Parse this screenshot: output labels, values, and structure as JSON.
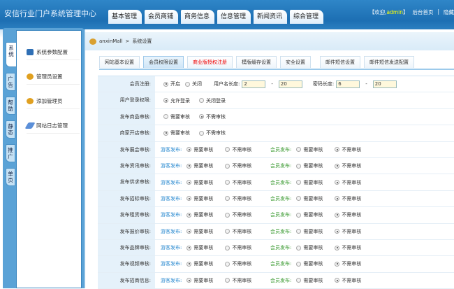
{
  "header": {
    "title": "安信行业门户系统管理中心",
    "nav": [
      "基本管理",
      "会员商铺",
      "商务信息",
      "信息管理",
      "新闻资讯",
      "综合管理"
    ],
    "welcome_prefix": "【欢迎,",
    "user": "admin",
    "welcome_suffix": "】",
    "home": "后台首页",
    "sep": "|",
    "hide": "隐藏"
  },
  "sidebar": {
    "tabs": [
      "系统",
      "广告",
      "帮助",
      "静态",
      "推广",
      "单页"
    ],
    "items": [
      {
        "label": "系统参数配置",
        "icon": "monitor-icon"
      },
      {
        "label": "管理员设置",
        "icon": "user-edit-icon"
      },
      {
        "label": "添加管理员",
        "icon": "user-add-icon"
      },
      {
        "label": "网站日志管理",
        "icon": "pen-icon"
      }
    ]
  },
  "breadcrumb": {
    "site": "anxinMall",
    "sep": ">",
    "page": "系统设置"
  },
  "tabs": [
    "网站基本设置",
    "会员权限设置",
    "商业版授权注册",
    "模版缓存设置",
    "安全设置",
    "邮件短信设置",
    "邮件短信发送配置"
  ],
  "active_tab": 1,
  "form": {
    "register": {
      "label": "会员注册:",
      "open": "开启",
      "close": "关闭",
      "selected": "开启",
      "username_label": "用户名长度:",
      "username_min": "2",
      "username_max": "20",
      "dash": "-",
      "password_label": "密码长度:",
      "password_min": "6",
      "password_max": "20"
    },
    "login": {
      "label": "用户登录权限:",
      "options": [
        "允许登录",
        "关闭登录"
      ],
      "selected": 0
    },
    "goods": {
      "label": "发布商品审核:",
      "options": [
        "需要审核",
        "不需审核"
      ],
      "selected": 1
    },
    "shop": {
      "label": "商家开店审核:",
      "options": [
        "需要审核",
        "不需审核"
      ],
      "selected": 0
    },
    "guest_label": "游客发布:",
    "member_label": "会员发布:",
    "opt_need": "需要审核",
    "opt_no": "不需审核",
    "audits": [
      {
        "label": "发布展会审核:",
        "guest": "需要审核",
        "member": "不需审核"
      },
      {
        "label": "发布资讯审核:",
        "guest": "需要审核",
        "member": "不需审核"
      },
      {
        "label": "发布供求审核:",
        "guest": "需要审核",
        "member": "不需审核"
      },
      {
        "label": "发布招标审核:",
        "guest": "需要审核",
        "member": "不需审核"
      },
      {
        "label": "发布租赁审核:",
        "guest": "需要审核",
        "member": "不需审核"
      },
      {
        "label": "发布报价审核:",
        "guest": "需要审核",
        "member": "不需审核"
      },
      {
        "label": "发布品牌审核:",
        "guest": "需要审核",
        "member": "不需审核"
      },
      {
        "label": "发布视频审核:",
        "guest": "需要审核",
        "member": "不需审核"
      },
      {
        "label": "发布招商信息:",
        "guest": "需要审核",
        "member": "不需审核"
      }
    ]
  },
  "colors": {
    "guest": "#2a8ad0",
    "member": "#3a9a30",
    "red_tab": "#e00000"
  }
}
